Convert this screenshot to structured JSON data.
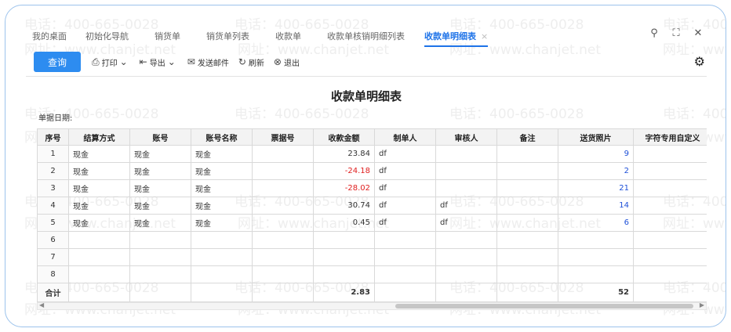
{
  "tabs": [
    {
      "label": "我的桌面",
      "active": false
    },
    {
      "label": "初始化导航",
      "active": false
    },
    {
      "label": "销货单",
      "active": false
    },
    {
      "label": "销货单列表",
      "active": false
    },
    {
      "label": "收款单",
      "active": false
    },
    {
      "label": "收款单核销明细列表",
      "active": false
    },
    {
      "label": "收款单明细表",
      "active": true
    }
  ],
  "tab_close_glyph": "×",
  "window_controls": {
    "search": "⚲",
    "maximize": "⛶",
    "close": "✕"
  },
  "toolbar": {
    "query": "查询",
    "print": "打印",
    "export": "导出",
    "send_email": "发送邮件",
    "refresh": "刷新",
    "exit": "退出"
  },
  "report": {
    "title": "收款单明细表",
    "date_label": "单据日期:"
  },
  "table": {
    "headers": [
      "序号",
      "结算方式",
      "账号",
      "账号名称",
      "票据号",
      "收款金额",
      "制单人",
      "审核人",
      "备注",
      "送货照片",
      "字符专用自定义"
    ],
    "rows": [
      {
        "seq": "1",
        "method": "现金",
        "account": "现金",
        "account_name": "现金",
        "bill_no": "",
        "amount": "23.84",
        "creator": "df",
        "auditor": "",
        "remark": "",
        "photos": "9",
        "custom": ""
      },
      {
        "seq": "2",
        "method": "现金",
        "account": "现金",
        "account_name": "现金",
        "bill_no": "",
        "amount": "-24.18",
        "creator": "df",
        "auditor": "",
        "remark": "",
        "photos": "2",
        "custom": ""
      },
      {
        "seq": "3",
        "method": "现金",
        "account": "现金",
        "account_name": "现金",
        "bill_no": "",
        "amount": "-28.02",
        "creator": "df",
        "auditor": "",
        "remark": "",
        "photos": "21",
        "custom": ""
      },
      {
        "seq": "4",
        "method": "现金",
        "account": "现金",
        "account_name": "现金",
        "bill_no": "",
        "amount": "30.74",
        "creator": "df",
        "auditor": "df",
        "remark": "",
        "photos": "14",
        "custom": ""
      },
      {
        "seq": "5",
        "method": "现金",
        "account": "现金",
        "account_name": "现金",
        "bill_no": "",
        "amount": "0.45",
        "creator": "df",
        "auditor": "df",
        "remark": "",
        "photos": "6",
        "custom": ""
      },
      {
        "seq": "6",
        "method": "",
        "account": "",
        "account_name": "",
        "bill_no": "",
        "amount": "",
        "creator": "",
        "auditor": "",
        "remark": "",
        "photos": "",
        "custom": ""
      },
      {
        "seq": "7",
        "method": "",
        "account": "",
        "account_name": "",
        "bill_no": "",
        "amount": "",
        "creator": "",
        "auditor": "",
        "remark": "",
        "photos": "",
        "custom": ""
      },
      {
        "seq": "8",
        "method": "",
        "account": "",
        "account_name": "",
        "bill_no": "",
        "amount": "",
        "creator": "",
        "auditor": "",
        "remark": "",
        "photos": "",
        "custom": ""
      }
    ],
    "total": {
      "label": "合计",
      "amount": "2.83",
      "photos": "52"
    }
  },
  "watermark": {
    "phone": "电话：400-665-0028",
    "site": "网址：www.chanjet.net"
  },
  "colors": {
    "accent": "#2d8cf0",
    "active_tab": "#1e73e8",
    "negative": "#e02020",
    "link": "#1e50d8"
  }
}
